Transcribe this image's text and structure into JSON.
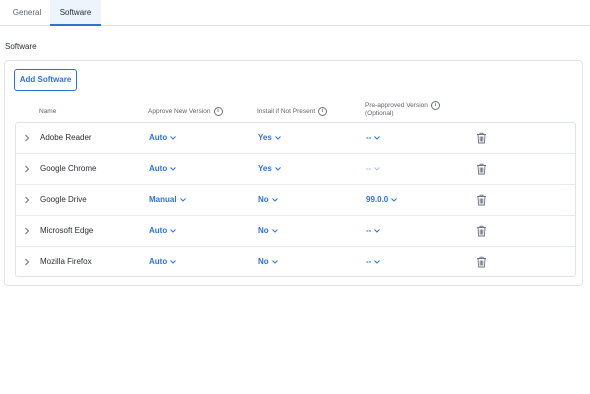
{
  "tabs": [
    {
      "label": "General"
    },
    {
      "label": "Software"
    }
  ],
  "section_title": "Software",
  "add_button_label": "Add Software",
  "columns": {
    "name": "Name",
    "approve": "Approve New Version",
    "install": "Install if Not Present",
    "preapproved_line1": "Pre-approved Version",
    "preapproved_line2": "(Optional)"
  },
  "rows": [
    {
      "name": "Adobe Reader",
      "approve": "Auto",
      "install": "Yes",
      "preapproved": "--"
    },
    {
      "name": "Google Chrome",
      "approve": "Auto",
      "install": "Yes",
      "preapproved": "--"
    },
    {
      "name": "Google Drive",
      "approve": "Manual",
      "install": "No",
      "preapproved": "99.0.0"
    },
    {
      "name": "Microsoft Edge",
      "approve": "Auto",
      "install": "No",
      "preapproved": "--"
    },
    {
      "name": "Mozilla Firefox",
      "approve": "Auto",
      "install": "No",
      "preapproved": "--"
    }
  ],
  "colors": {
    "accent": "#2a74d6",
    "border": "#e0e4e9"
  }
}
